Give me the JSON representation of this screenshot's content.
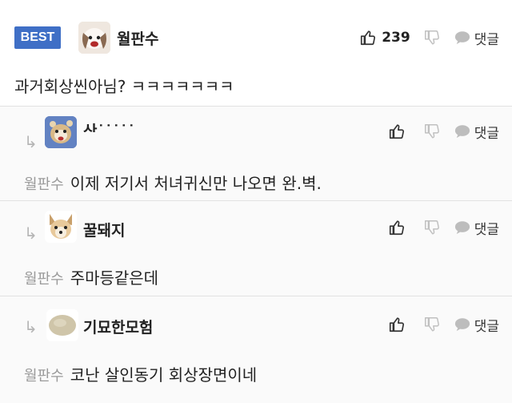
{
  "best_comment": {
    "badge": "BEST",
    "author": "월판수",
    "likes": "239",
    "reply_label": "댓글",
    "text": "과거회상씬아님? ㅋㅋㅋㅋㅋㅋㅋ"
  },
  "replies": [
    {
      "author": "산˙˙˙˙˙",
      "mention": "월판수",
      "text": "이제 저기서 처녀귀신만 나오면 완.벽.",
      "reply_label": "댓글"
    },
    {
      "author": "꿀돼지",
      "mention": "월판수",
      "text": "주마등같은데",
      "reply_label": "댓글"
    },
    {
      "author": "기묘한모험",
      "mention": "월판수",
      "text": "코난 살인동기 회상장면이네",
      "reply_label": "댓글"
    }
  ]
}
